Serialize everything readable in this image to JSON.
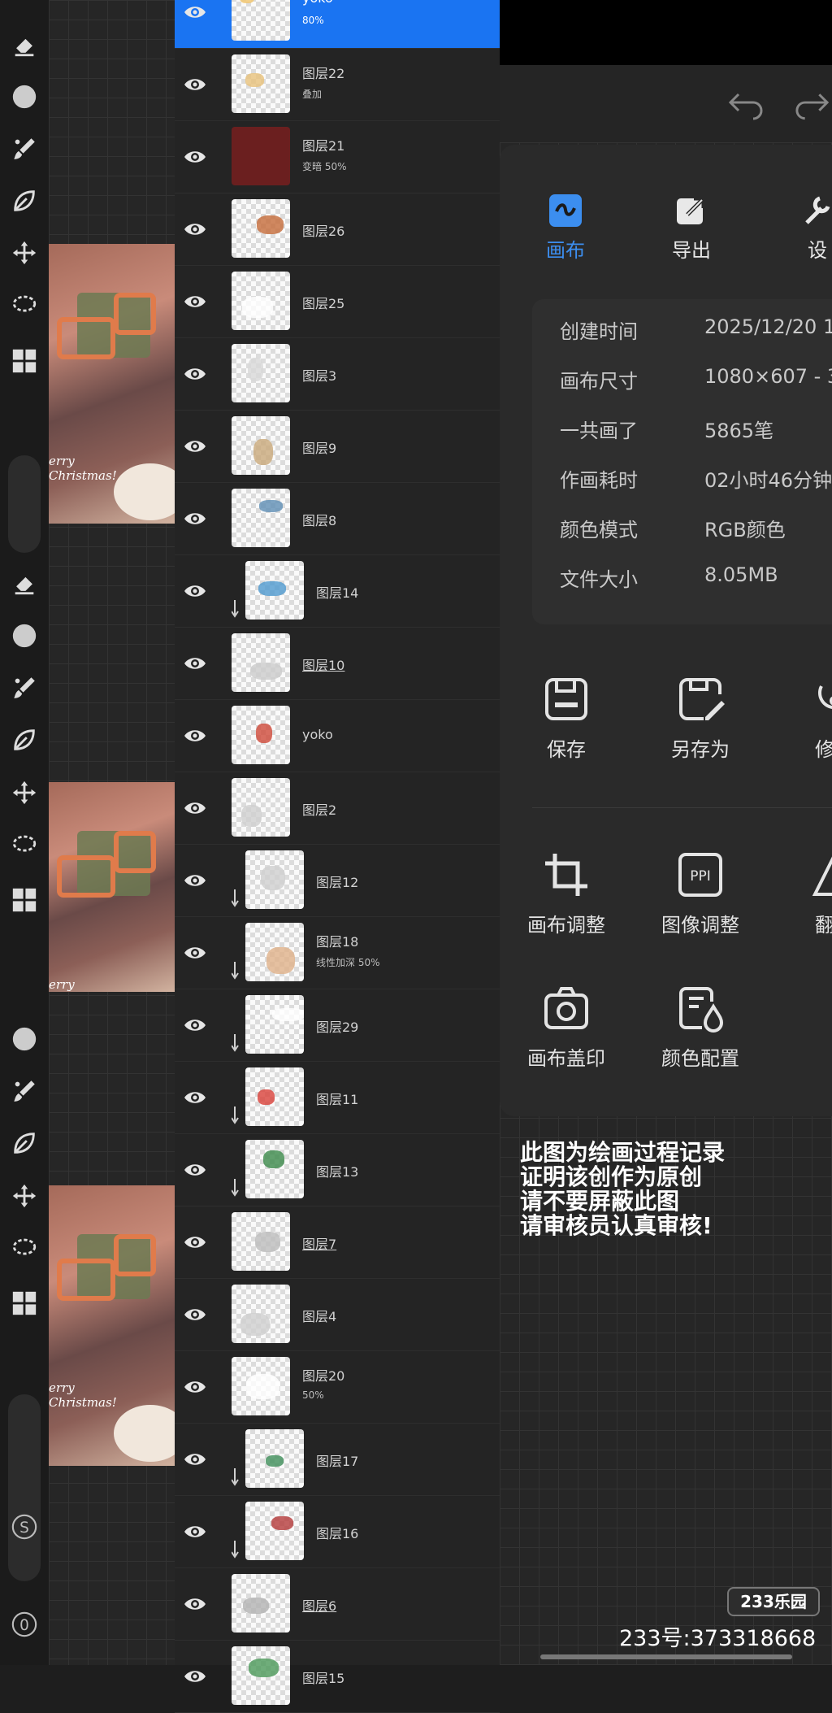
{
  "layers": [
    {
      "name": "yoko",
      "mode": "80%",
      "selected": true,
      "clipped": false,
      "underline": false
    },
    {
      "name": "图层22",
      "mode": "叠加",
      "selected": false,
      "clipped": false,
      "underline": false
    },
    {
      "name": "图层21",
      "mode": "变暗    50%",
      "selected": false,
      "clipped": false,
      "underline": false
    },
    {
      "name": "图层26",
      "mode": "",
      "selected": false,
      "clipped": false,
      "underline": false
    },
    {
      "name": "图层25",
      "mode": "",
      "selected": false,
      "clipped": false,
      "underline": false
    },
    {
      "name": "图层3",
      "mode": "",
      "selected": false,
      "clipped": false,
      "underline": false
    },
    {
      "name": "图层9",
      "mode": "",
      "selected": false,
      "clipped": false,
      "underline": false
    },
    {
      "name": "图层8",
      "mode": "",
      "selected": false,
      "clipped": false,
      "underline": false
    },
    {
      "name": "图层14",
      "mode": "",
      "selected": false,
      "clipped": true,
      "underline": false
    },
    {
      "name": "图层10",
      "mode": "",
      "selected": false,
      "clipped": false,
      "underline": true
    },
    {
      "name": "yoko",
      "mode": "",
      "selected": false,
      "clipped": false,
      "underline": false
    },
    {
      "name": "图层2",
      "mode": "",
      "selected": false,
      "clipped": false,
      "underline": false
    },
    {
      "name": "图层12",
      "mode": "",
      "selected": false,
      "clipped": true,
      "underline": false
    },
    {
      "name": "图层18",
      "mode": "线性加深    50%",
      "selected": false,
      "clipped": true,
      "underline": false
    },
    {
      "name": "图层29",
      "mode": "",
      "selected": false,
      "clipped": true,
      "underline": false
    },
    {
      "name": "图层11",
      "mode": "",
      "selected": false,
      "clipped": true,
      "underline": false
    },
    {
      "name": "图层13",
      "mode": "",
      "selected": false,
      "clipped": true,
      "underline": false
    },
    {
      "name": "图层7",
      "mode": "",
      "selected": false,
      "clipped": false,
      "underline": true
    },
    {
      "name": "图层4",
      "mode": "",
      "selected": false,
      "clipped": false,
      "underline": false
    },
    {
      "name": "图层20",
      "mode": "50%",
      "selected": false,
      "clipped": false,
      "underline": false
    },
    {
      "name": "图层17",
      "mode": "",
      "selected": false,
      "clipped": true,
      "underline": false
    },
    {
      "name": "图层16",
      "mode": "",
      "selected": false,
      "clipped": true,
      "underline": false
    },
    {
      "name": "图层6",
      "mode": "",
      "selected": false,
      "clipped": false,
      "underline": true
    },
    {
      "name": "图层15",
      "mode": "",
      "selected": false,
      "clipped": false,
      "underline": false
    }
  ],
  "artwork": {
    "caption_line1": "erry",
    "caption_line2": "Christmas!"
  },
  "tabs": [
    {
      "label": "画布",
      "icon": "canvas-tab-icon",
      "active": true
    },
    {
      "label": "导出",
      "icon": "export-icon",
      "active": false
    },
    {
      "label": "设",
      "icon": "settings-icon",
      "active": false
    }
  ],
  "info": [
    {
      "key": "创建时间",
      "value": "2025/12/20 1"
    },
    {
      "key": "画布尺寸",
      "value": "1080×607 - 3"
    },
    {
      "key": "一共画了",
      "value": "5865笔"
    },
    {
      "key": "作画耗时",
      "value": "02小时46分钟"
    },
    {
      "key": "颜色模式",
      "value": "RGB颜色"
    },
    {
      "key": "文件大小",
      "value": "8.05MB"
    }
  ],
  "actions": {
    "save": "保存",
    "save_as": "另存为",
    "repair": "修复",
    "canvas_adjust": "画布调整",
    "image_adjust": "图像调整",
    "flip": "翻转",
    "canvas_stamp": "画布盖印",
    "color_config": "颜色配置"
  },
  "ppi_label": "PPI",
  "notice": [
    "此图为绘画过程记录",
    "证明该创作为原创",
    "请不要屏蔽此图",
    "请审核员认真审核!"
  ],
  "watermark": {
    "badge": "233乐园",
    "uid": "233号:373318668"
  },
  "toolbar_letters": {
    "smudge": "S",
    "opacity": "0"
  },
  "colors": {
    "accent": "#1a74f2",
    "tab_active": "#3c8eef",
    "panel": "#2a2a2a"
  }
}
